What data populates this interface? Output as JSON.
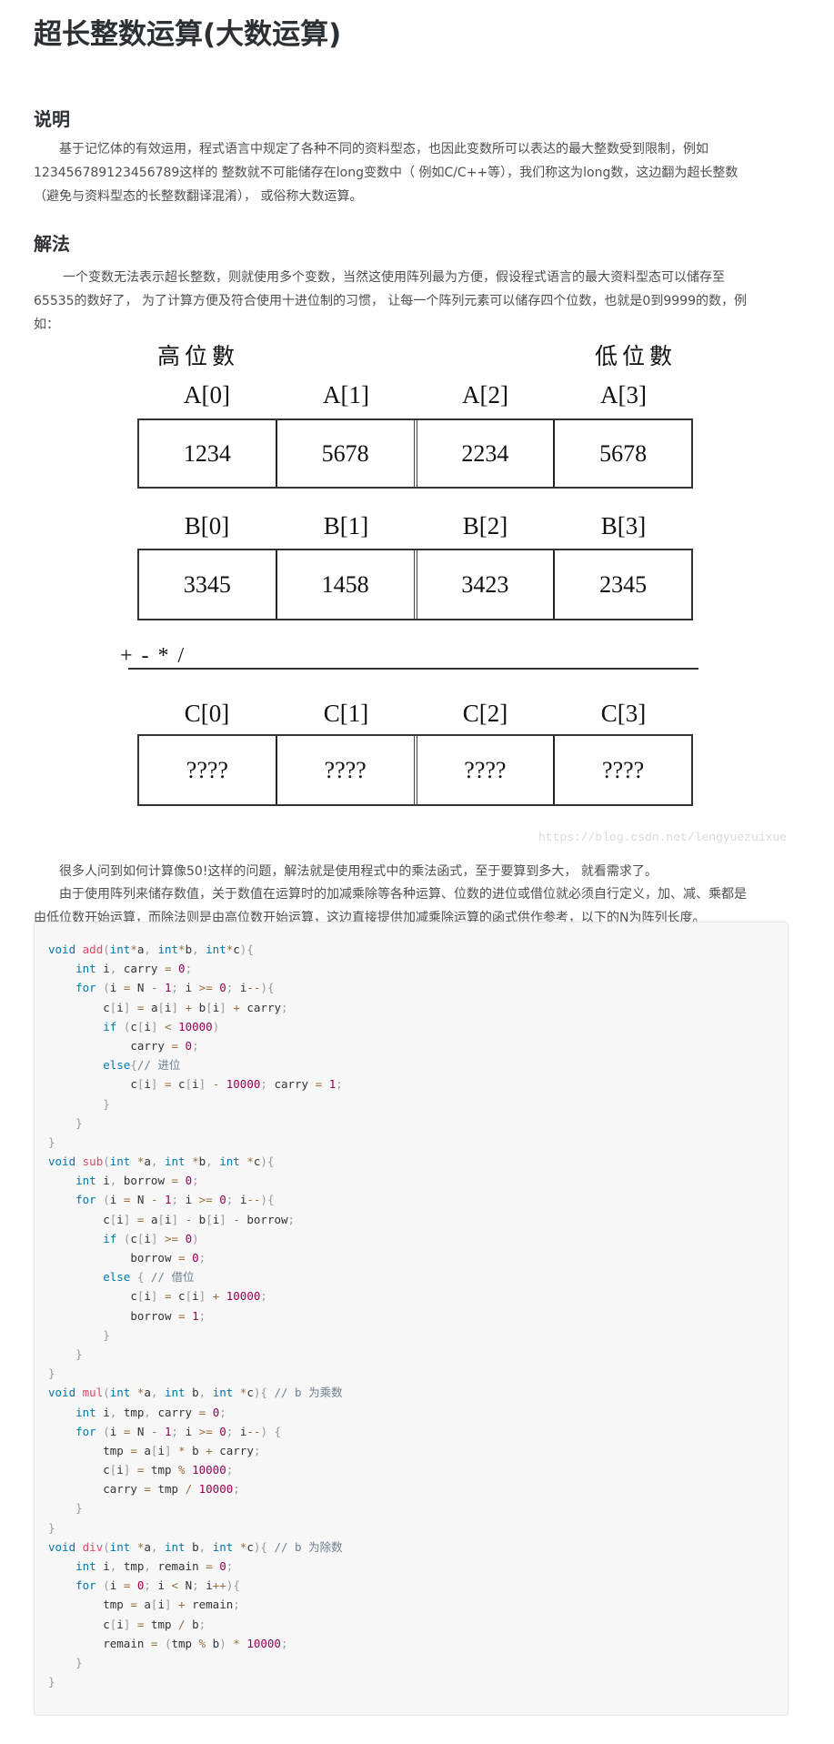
{
  "article": {
    "title": "超长整数运算(大数运算)",
    "sections": [
      {
        "heading": "说明",
        "lines": [
          "基于记忆体的有效运用，程式语言中规定了各种不同的资料型态，也因此变数所可以表达的最大整数受到限制，例如",
          "123456789123456789这样的 整数就不可能储存在long变数中（ 例如C/C++等），我们称这为long数，这边翻为超长整数",
          "（避免与资料型态的长整数翻译混淆），  或俗称大数运算。"
        ]
      },
      {
        "heading": "解法",
        "lines": [
          "一个变数无法表示超长整数，则就使用多个变数，当然这使用阵列最为方便，假设程式语言的最大资料型态可以储存至",
          "65535的数好了，  为了计算方便及符合使用十进位制的习惯，  让每一个阵列元素可以储存四个位数，也就是0到9999的数，例",
          "如："
        ]
      }
    ],
    "after_diagram": {
      "p1": "很多人问到如何计算像50!这样的问题，解法就是使用程式中的乘法函式，至于要算到多大，  就看需求了。",
      "p2_lines": [
        "由于使用阵列来储存数值，关于数值在运算时的加减乘除等各种运算、位数的进位或借位就必须自行定义，加、减、乘都是",
        "由低位数开始运算，而除法则是由高位数开始运算，这边直接提供加减乘除运算的函式供作参考，以下的N为阵列长度。"
      ]
    }
  },
  "diagram": {
    "high_label": "高位數",
    "low_label": "低位數",
    "operator_label": "+ - * /",
    "watermark": "https://blog.csdn.net/lengyuezuixue",
    "rows": [
      {
        "labels": [
          "A[0]",
          "A[1]",
          "A[2]",
          "A[3]"
        ],
        "values": [
          "1234",
          "5678",
          "2234",
          "5678"
        ]
      },
      {
        "labels": [
          "B[0]",
          "B[1]",
          "B[2]",
          "B[3]"
        ],
        "values": [
          "3345",
          "1458",
          "3423",
          "2345"
        ]
      },
      {
        "labels": [
          "C[0]",
          "C[1]",
          "C[2]",
          "C[3]"
        ],
        "values": [
          "????",
          "????",
          "????",
          "????"
        ]
      }
    ]
  },
  "code": {
    "language": "c",
    "colors": {
      "keyword": "#0077aa",
      "function": "#dd4a68",
      "number": "#990055",
      "operator": "#9a6e3a",
      "punctuation": "#999999",
      "comment": "#708090"
    },
    "lines": [
      "void add(int*a, int*b, int*c){",
      "    int i, carry = 0;",
      "    for (i = N - 1; i >= 0; i--){",
      "        c[i] = a[i] + b[i] + carry;",
      "        if (c[i] < 10000)",
      "            carry = 0;",
      "        else{// 进位",
      "            c[i] = c[i] - 10000; carry = 1;",
      "        }",
      "    }",
      "}",
      "void sub(int *a, int *b, int *c){",
      "    int i, borrow = 0;",
      "    for (i = N - 1; i >= 0; i--){",
      "        c[i] = a[i] - b[i] - borrow;",
      "        if (c[i] >= 0)",
      "            borrow = 0;",
      "        else { // 借位",
      "            c[i] = c[i] + 10000;",
      "            borrow = 1;",
      "        }",
      "    }",
      "}",
      "void mul(int *a, int b, int *c){ // b 为乘数",
      "    int i, tmp, carry = 0;",
      "    for (i = N - 1; i >= 0; i--) {",
      "        tmp = a[i] * b + carry;",
      "        c[i] = tmp % 10000;",
      "        carry = tmp / 10000;",
      "    }",
      "}",
      "void div(int *a, int b, int *c){ // b 为除数",
      "    int i, tmp, remain = 0;",
      "    for (i = 0; i < N; i++){",
      "        tmp = a[i] + remain;",
      "        c[i] = tmp / b;",
      "        remain = (tmp % b) * 10000;",
      "    }",
      "}"
    ]
  }
}
